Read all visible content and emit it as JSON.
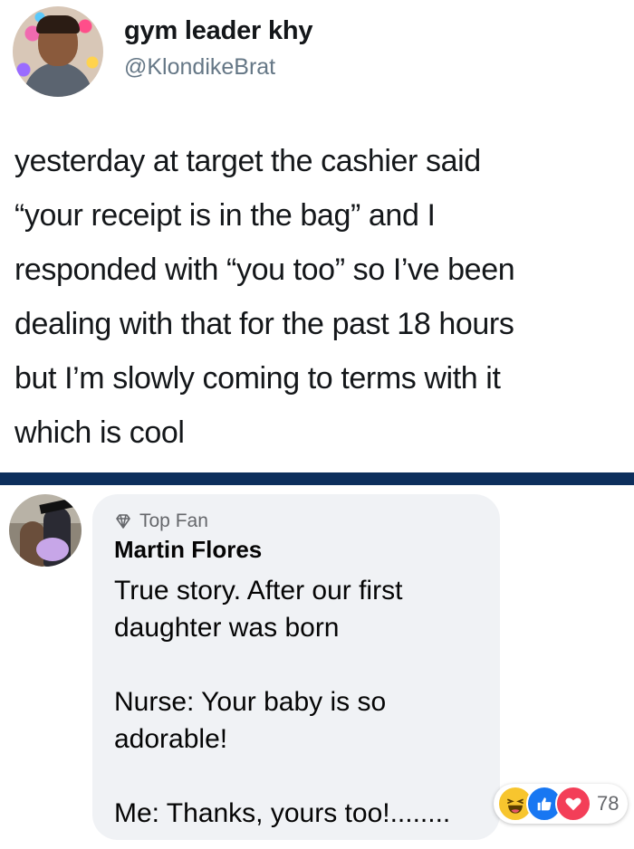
{
  "tweet": {
    "display_name": "gym leader khy",
    "handle": "@KlondikeBrat",
    "text_lines": [
      "yesterday at target the cashier said",
      "“your receipt is in the bag” and I",
      "responded with “you too” so I’ve been",
      "dealing with that for the past 18 hours",
      "but I’m slowly coming to terms with it",
      "which is cool"
    ]
  },
  "divider_color": "#0d2f5c",
  "comment": {
    "badge_icon": "diamond-icon",
    "badge_label": "Top Fan",
    "author": "Martin Flores",
    "text_lines": [
      "True story. After our first",
      "daughter was born",
      "",
      "Nurse: Your baby is so",
      "adorable!",
      "",
      "Me: Thanks, yours too!........"
    ],
    "reactions": {
      "icons": [
        "haha-icon",
        "like-icon",
        "love-icon"
      ],
      "count": "78"
    }
  }
}
